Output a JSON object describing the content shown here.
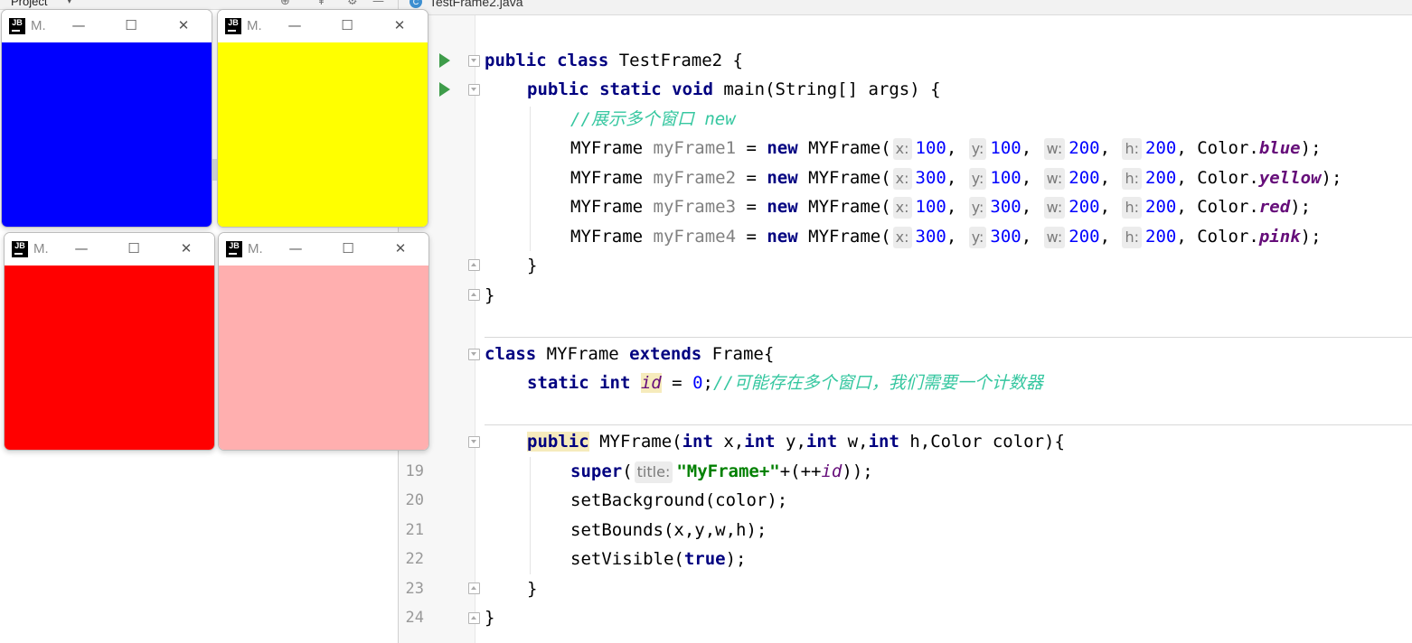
{
  "project_panel": {
    "title": "Project",
    "dropdown_icon": "chevron-down-icon"
  },
  "editor": {
    "tab": {
      "label": "TestFrame2.java",
      "icon": "C"
    }
  },
  "line_numbers": [
    "19",
    "20",
    "21",
    "22",
    "23",
    "24"
  ],
  "code": {
    "l1": {
      "kw1": "public class",
      "rest": " TestFrame2 {"
    },
    "l2": {
      "kw1": "public static void",
      "rest": " main(String[] args) {"
    },
    "l3": {
      "comment": "//展示多个窗口 new"
    },
    "frames_calls": [
      {
        "type": "MYFrame ",
        "var": "myFrame1",
        "eq": " = ",
        "new": "new",
        "ctor": " MYFrame(",
        "hx": "x:",
        "x": "100",
        "hy": "y:",
        "y": "100",
        "hw": "w:",
        "w": "200",
        "hh": "h:",
        "h": "200",
        "color_prefix": "Color.",
        "color": "blue",
        "end": ");"
      },
      {
        "type": "MYFrame ",
        "var": "myFrame2",
        "eq": " = ",
        "new": "new",
        "ctor": " MYFrame(",
        "hx": "x:",
        "x": "300",
        "hy": "y:",
        "y": "100",
        "hw": "w:",
        "w": "200",
        "hh": "h:",
        "h": "200",
        "color_prefix": "Color.",
        "color": "yellow",
        "end": ");"
      },
      {
        "type": "MYFrame ",
        "var": "myFrame3",
        "eq": " = ",
        "new": "new",
        "ctor": " MYFrame(",
        "hx": "x:",
        "x": "100",
        "hy": "y:",
        "y": "300",
        "hw": "w:",
        "w": "200",
        "hh": "h:",
        "h": "200",
        "color_prefix": "Color.",
        "color": "red",
        "end": ");"
      },
      {
        "type": "MYFrame ",
        "var": "myFrame4",
        "eq": " = ",
        "new": "new",
        "ctor": " MYFrame(",
        "hx": "x:",
        "x": "300",
        "hy": "y:",
        "y": "300",
        "hw": "w:",
        "w": "200",
        "hh": "h:",
        "h": "200",
        "color_prefix": "Color.",
        "color": "pink",
        "end": ");"
      }
    ],
    "close_brace": "}",
    "class_kw": "class",
    "class_name": " MYFrame ",
    "extends_kw": "extends",
    "class_rest": " Frame{",
    "static_int": "static int",
    "id_field": "id",
    "id_rest_a": " = ",
    "id_zero": "0",
    "id_rest_b": ";",
    "id_comment": "//可能存在多个窗口，我们需要一个计数器",
    "ctor_public": "public",
    "ctor_name": " MYFrame(",
    "int1": "int",
    "p1": " x,",
    "int2": "int",
    "p2": " y,",
    "int3": "int",
    "p3": " w,",
    "int4": "int",
    "p4": " h,Color color){",
    "super_kw": "super",
    "super_open": "(",
    "title_hint": "title:",
    "super_str": "\"MyFrame+\"",
    "super_mid": "+(++",
    "super_id": "id",
    "super_end": "));",
    "set_bg": "setBackground(color);",
    "set_bounds": "setBounds(x,y,w,h);",
    "set_vis_a": "setVisible(",
    "set_vis_true": "true",
    "set_vis_b": ");"
  },
  "frames": [
    {
      "title": "M.",
      "color": "#0000ff",
      "logo": "JB"
    },
    {
      "title": "M.",
      "color": "#ffff00",
      "logo": "JB"
    },
    {
      "title": "M.",
      "color": "#ff0000",
      "logo": "JB"
    },
    {
      "title": "M.",
      "color": "#ffafaf",
      "logo": "JB"
    }
  ],
  "window_controls": {
    "minimize": "—",
    "maximize": "☐",
    "close": "✕"
  }
}
